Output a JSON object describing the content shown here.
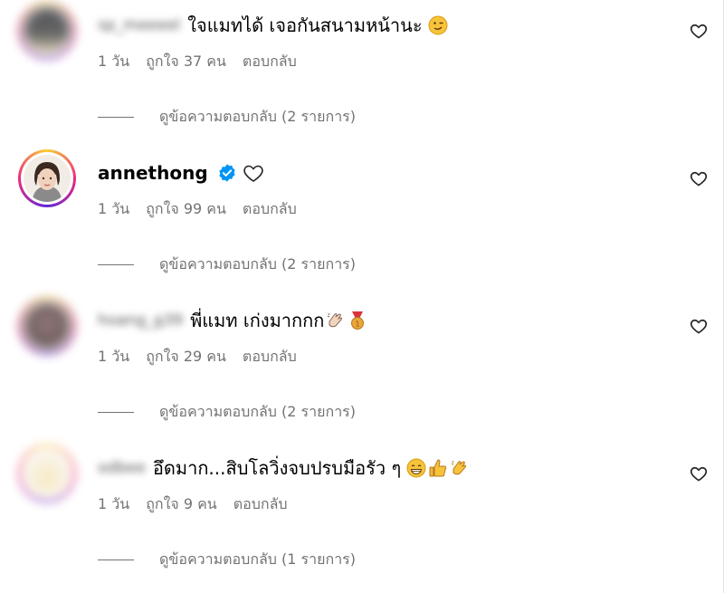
{
  "comments": [
    {
      "username": "sp_meeeel",
      "text": "ใจแมทได้ เจอกันสนามหน้านะ",
      "emojis": [
        "wink-emoji"
      ],
      "time": "1 วัน",
      "likes": "ถูกใจ 37 คน",
      "reply": "ตอบกลับ",
      "view_replies": "ดูข้อความตอบกลับ (2 รายการ)"
    },
    {
      "username": "annethong",
      "text": "",
      "emojis": [
        "verified-icon",
        "outline-heart-icon"
      ],
      "time": "1 วัน",
      "likes": "ถูกใจ 99 คน",
      "reply": "ตอบกลับ",
      "view_replies": "ดูข้อความตอบกลับ (2 รายการ)"
    },
    {
      "username": "hoang_g39",
      "text": "พี่แมท เก่งมากกก",
      "emojis": [
        "clapping-hands-emoji",
        "medal-emoji"
      ],
      "time": "1 วัน",
      "likes": "ถูกใจ 29 คน",
      "reply": "ตอบกลับ",
      "view_replies": "ดูข้อความตอบกลับ (2 รายการ)"
    },
    {
      "username": "odbee",
      "text": "อึดมาก...สิบโลวิ่งจบปรบมือรัว ๆ",
      "emojis": [
        "grin-emoji",
        "thumbs-up-emoji",
        "clapping-hands-emoji"
      ],
      "time": "1 วัน",
      "likes": "ถูกใจ 9 คน",
      "reply": "ตอบกลับ",
      "view_replies": "ดูข้อความตอบกลับ (1 รายการ)"
    }
  ],
  "colors": {
    "meta_text": "#737373",
    "verified_blue": "#0095f6",
    "emoji_yellow": "#f7c33b"
  }
}
